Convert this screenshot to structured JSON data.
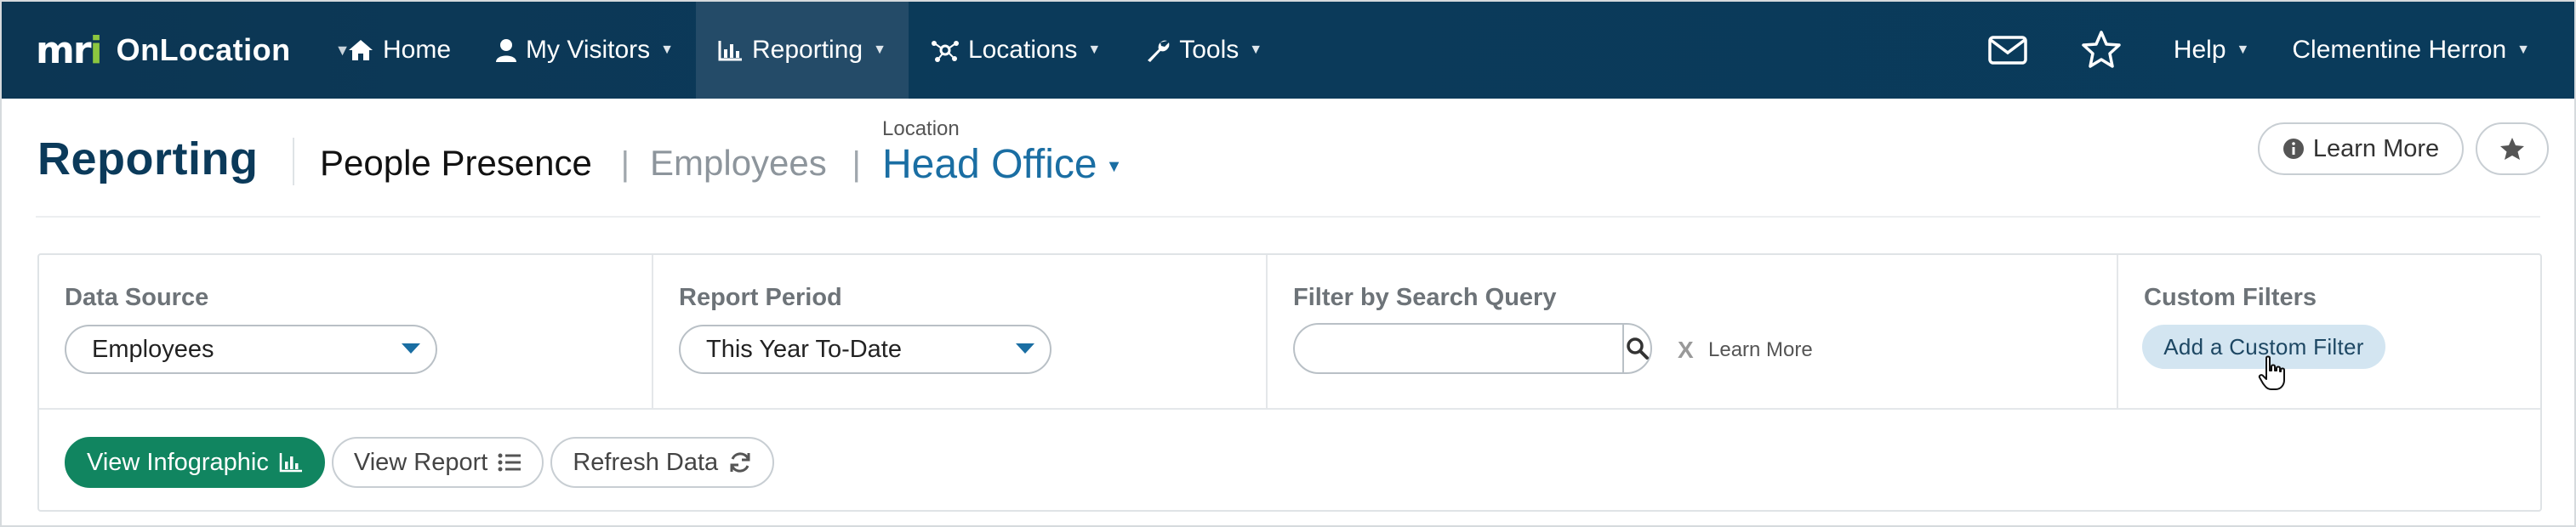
{
  "topnav": {
    "brand_logo": "mri",
    "brand_name": "OnLocation",
    "items": [
      {
        "label": "Home",
        "icon": "home-icon"
      },
      {
        "label": "My Visitors",
        "icon": "user-icon"
      },
      {
        "label": "Reporting",
        "icon": "bar-chart-icon",
        "active": true
      },
      {
        "label": "Locations",
        "icon": "network-icon"
      },
      {
        "label": "Tools",
        "icon": "wrench-icon"
      }
    ],
    "help_label": "Help",
    "user_name": "Clementine Herron"
  },
  "header": {
    "title": "Reporting",
    "current_report": "People Presence",
    "pipe": "|",
    "sub_report": "Employees",
    "location_label": "Location",
    "location_value": "Head Office",
    "learn_more": "Learn More"
  },
  "filters": {
    "data_source": {
      "label": "Data Source",
      "value": "Employees"
    },
    "report_period": {
      "label": "Report Period",
      "value": "This Year To-Date"
    },
    "search_query": {
      "label": "Filter by Search Query",
      "value": "",
      "clear": "X",
      "learn_more": "Learn More"
    },
    "custom_filters": {
      "label": "Custom Filters",
      "add_button": "Add a Custom Filter"
    }
  },
  "actions": {
    "view_infographic": "View Infographic",
    "view_report": "View Report",
    "refresh_data": "Refresh Data"
  },
  "colors": {
    "nav_bg": "#0b3a5a",
    "accent_blue": "#1a6ea3",
    "primary_green": "#118560",
    "logo_green": "#8cc63f",
    "custom_filter_bg": "#d3e5f1"
  }
}
